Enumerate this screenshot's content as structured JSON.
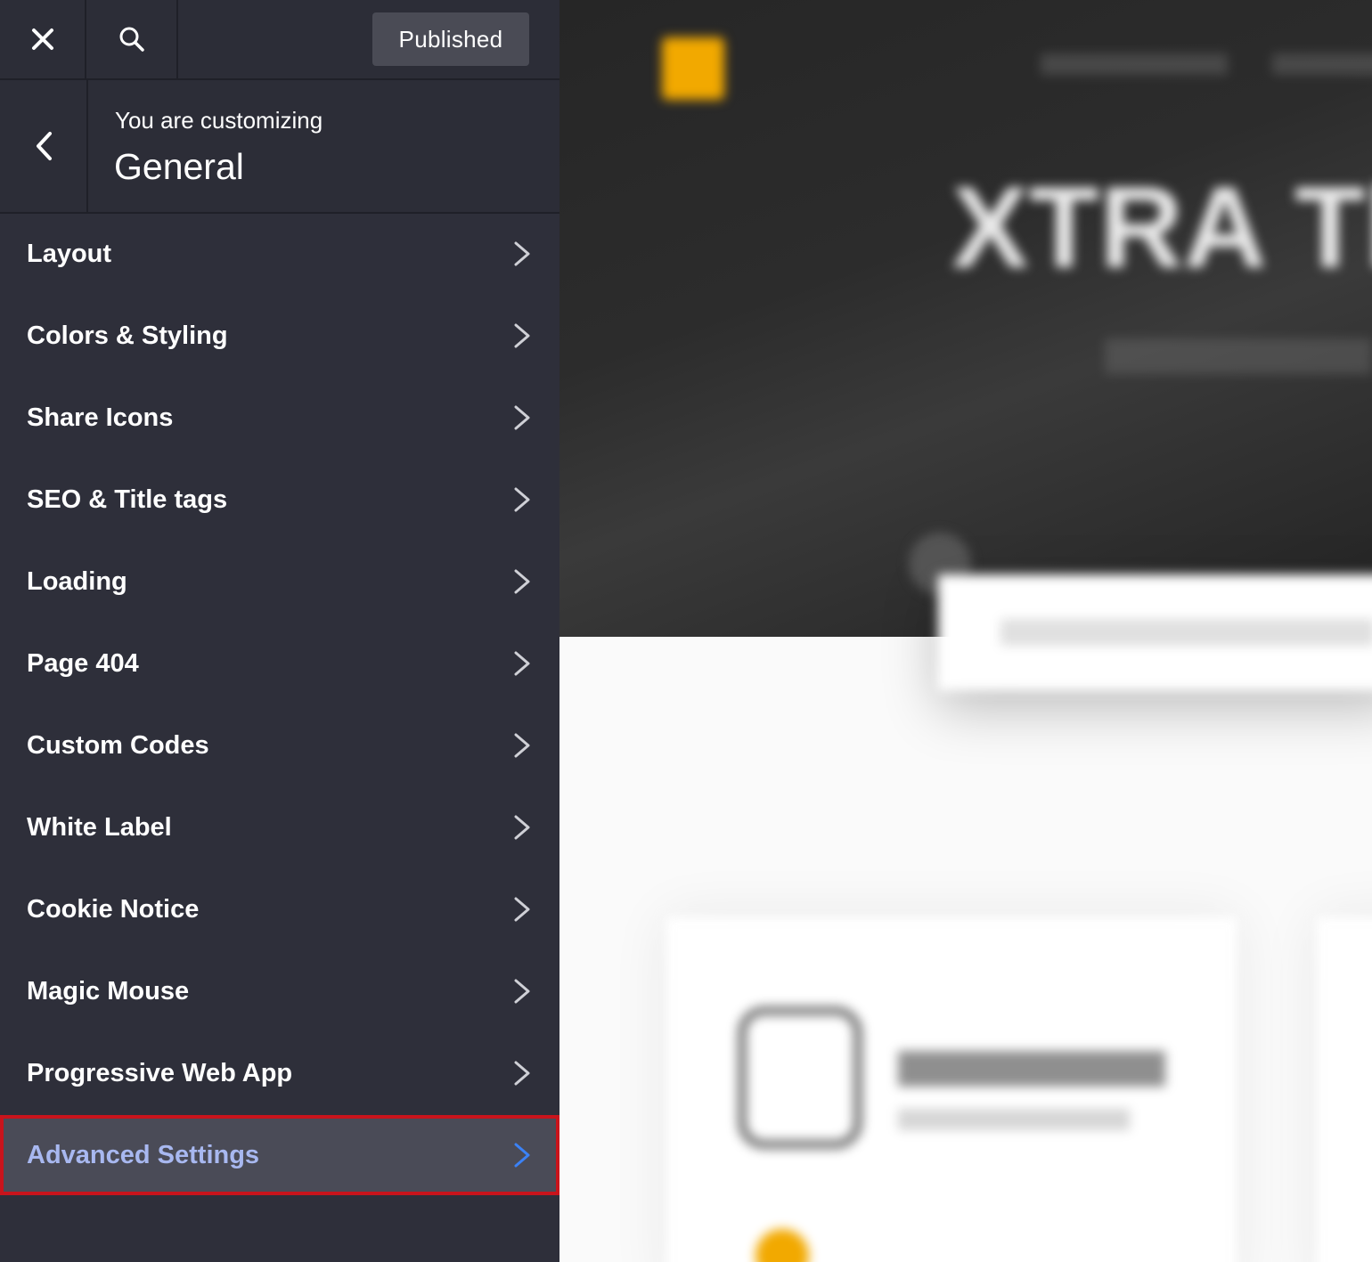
{
  "topbar": {
    "close_icon": "close-icon",
    "search_icon": "search-icon",
    "publish_label": "Published"
  },
  "panel": {
    "subtitle": "You are customizing",
    "title": "General",
    "back_icon": "chevron-left-icon"
  },
  "menu": {
    "items": [
      {
        "label": "Layout"
      },
      {
        "label": "Colors & Styling"
      },
      {
        "label": "Share Icons"
      },
      {
        "label": "SEO & Title tags"
      },
      {
        "label": "Loading"
      },
      {
        "label": "Page 404"
      },
      {
        "label": "Custom Codes"
      },
      {
        "label": "White Label"
      },
      {
        "label": "Cookie Notice"
      },
      {
        "label": "Magic Mouse"
      },
      {
        "label": "Progressive Web App"
      },
      {
        "label": "Advanced Settings"
      }
    ],
    "active_index": 11,
    "highlight_color": "#c8141c",
    "active_text_color": "#a8b8f0"
  },
  "preview": {
    "hero_title": "XTRA Th"
  }
}
